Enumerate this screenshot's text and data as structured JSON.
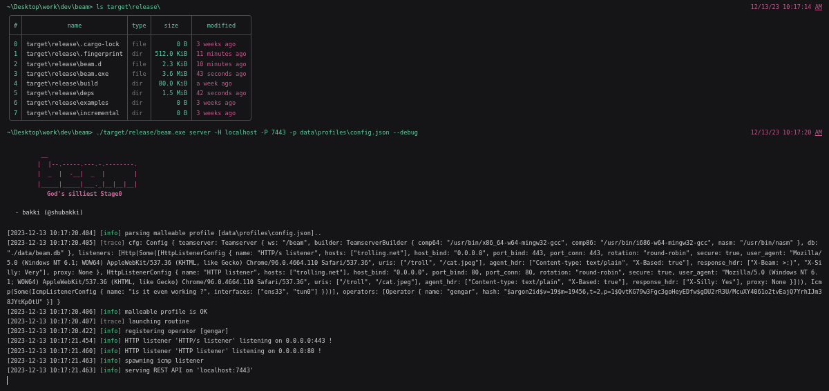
{
  "blocks": [
    {
      "prompt": {
        "path": "~\\Desktop\\work\\dev\\beam>",
        "command": "ls target\\release\\",
        "date": "12/13/23 10:17:14",
        "meridiem": "AM"
      },
      "table": {
        "columns": [
          "#",
          "name",
          "type",
          "size",
          "modified"
        ],
        "rows": [
          {
            "index": "0",
            "name": "target\\release\\.cargo-lock",
            "type": "file",
            "size": "0 B",
            "modified": "3 weeks ago"
          },
          {
            "index": "1",
            "name": "target\\release\\.fingerprint",
            "type": "dir",
            "size": "512.0 KiB",
            "modified": "11 minutes ago"
          },
          {
            "index": "2",
            "name": "target\\release\\beam.d",
            "type": "file",
            "size": "2.3 KiB",
            "modified": "10 minutes ago"
          },
          {
            "index": "3",
            "name": "target\\release\\beam.exe",
            "type": "file",
            "size": "3.6 MiB",
            "modified": "43 seconds ago"
          },
          {
            "index": "4",
            "name": "target\\release\\build",
            "type": "dir",
            "size": "80.0 KiB",
            "modified": "a week ago"
          },
          {
            "index": "5",
            "name": "target\\release\\deps",
            "type": "dir",
            "size": "1.5 MiB",
            "modified": "42 seconds ago"
          },
          {
            "index": "6",
            "name": "target\\release\\examples",
            "type": "dir",
            "size": "0 B",
            "modified": "3 weeks ago"
          },
          {
            "index": "7",
            "name": "target\\release\\incremental",
            "type": "dir",
            "size": "0 B",
            "modified": "3 weeks ago"
          }
        ]
      }
    },
    {
      "prompt": {
        "path": "~\\Desktop\\work\\dev\\beam>",
        "command": "./target/release/beam.exe server -H localhost -P 7443 -p data\\profiles\\config.json --debug",
        "date": "12/13/23 10:17:20",
        "meridiem": "AM"
      },
      "banner": {
        "art": [
          " __",
          "|  |--.-----.---.-.--------.",
          "|  _  |  -__|  _  |        |",
          "|_____|_____|___._|__|__|__|"
        ],
        "tagline": "God's silliest Stage0",
        "author": "- bakki (@shubakki)"
      },
      "logs": [
        {
          "time": "[2023-12-13 10:17:20.404]",
          "level": "[info]",
          "kind": "info",
          "message": "parsing malleable profile [data\\profiles\\config.json].."
        },
        {
          "time": "[2023-12-13 10:17:20.405]",
          "level": "[trace]",
          "kind": "trace",
          "message": "cfg: Config { teamserver: Teamserver { ws: \"/beam\", builder: TeamserverBuilder { comp64: \"/usr/bin/x86_64-w64-mingw32-gcc\", comp86: \"/usr/bin/i686-w64-mingw32-gcc\", nasm: \"/usr/bin/nasm\" }, db: \"./data/beam.db\" }, listeners: [Http(Some([HttpListenerConfig { name: \"HTTP/s listener\", hosts: [\"trolling.net\"], host_bind: \"0.0.0.0\", port_bind: 443, port_conn: 443, rotation: \"round-robin\", secure: true, user_agent: \"Mozilla/5.0 (Windows NT 6.1; WOW64) AppleWebKit/537.36 (KHTML, like Gecko) Chrome/96.0.4664.110 Safari/537.36\", uris: [\"/troll\", \"/cat.jpeg\"], agent_hdr: [\"Content-type: text/plain\", \"X-Based: true\"], response_hdr: [\"X-Beam: >:)\", \"X-Silly: Very\"], proxy: None }, HttpListenerConfig { name: \"HTTP listener\", hosts: [\"trolling.net\"], host_bind: \"0.0.0.0\", port_bind: 80, port_conn: 80, rotation: \"round-robin\", secure: true, user_agent: \"Mozilla/5.0 (Windows NT 6.1; WOW64) AppleWebKit/537.36 (KHTML, like Gecko) Chrome/96.0.4664.110 Safari/537.36\", uris: [\"/troll\", \"/cat.jpeg\"], agent_hdr: [\"Content-type: text/plain\", \"X-Based: true\"], response_hdr: [\"X-Silly: Yes\"], proxy: None }])), Icmp(Some(IcmpListenerConfig { name: \"is it even working ?\", interfaces: [\"ens33\", \"tun0\"] }))], operators: [Operator { name: \"gengar\", hash: \"$argon2id$v=19$m=19456,t=2,p=1$QvtKG79w3Fgc3goHeyEDfw$gDU2rR3U/McuXY4061o2tvEajQ7YrhIJm38JYtKpOtU\" }] }"
        },
        {
          "time": "[2023-12-13 10:17:20.406]",
          "level": "[info]",
          "kind": "info",
          "message": "malleable profile is OK"
        },
        {
          "time": "[2023-12-13 10:17:20.407]",
          "level": "[trace]",
          "kind": "trace",
          "message": "launching routine"
        },
        {
          "time": "[2023-12-13 10:17:20.422]",
          "level": "[info]",
          "kind": "info",
          "message": "registering operator [gengar]"
        },
        {
          "time": "[2023-12-13 10:17:21.454]",
          "level": "[info]",
          "kind": "info",
          "message": "HTTP listener 'HTTP/s listener' listening on 0.0.0.0:443 !"
        },
        {
          "time": "[2023-12-13 10:17:21.460]",
          "level": "[info]",
          "kind": "info",
          "message": "HTTP listener 'HTTP listener' listening on 0.0.0.0:80 !"
        },
        {
          "time": "[2023-12-13 10:17:21.463]",
          "level": "[info]",
          "kind": "info",
          "message": "spawning icmp listener"
        },
        {
          "time": "[2023-12-13 10:17:21.463]",
          "level": "[info]",
          "kind": "info",
          "message": "serving REST API on 'localhost:7443'"
        }
      ]
    }
  ]
}
